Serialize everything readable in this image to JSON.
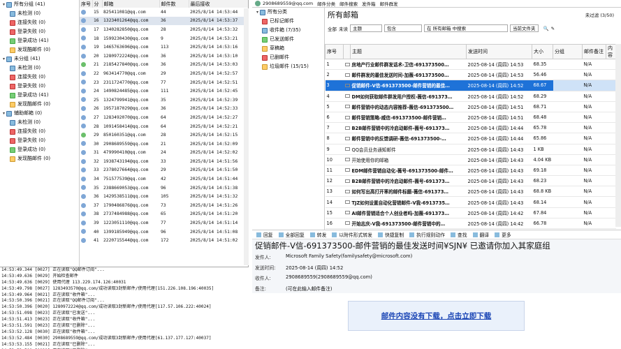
{
  "tree": [
    {
      "label": "所有分组 (41)",
      "level": 0,
      "icon": "group-icon",
      "exp": "▾"
    },
    {
      "label": "未检测 (0)",
      "level": 1,
      "icon": "blu"
    },
    {
      "label": "连接失败 (0)",
      "level": 1,
      "icon": "red"
    },
    {
      "label": "登录失败 (0)",
      "level": 1,
      "icon": "red"
    },
    {
      "label": "登录成功 (41)",
      "level": 1,
      "icon": "grn"
    },
    {
      "label": "发现酷邮件 (0)",
      "level": 1,
      "icon": "yel"
    },
    {
      "label": "未分组 (41)",
      "level": 0,
      "icon": "group-icon",
      "exp": "▾"
    },
    {
      "label": "未检测 (0)",
      "level": 1,
      "icon": "blu"
    },
    {
      "label": "连接失败 (0)",
      "level": 1,
      "icon": "red"
    },
    {
      "label": "登录失败 (0)",
      "level": 1,
      "icon": "red"
    },
    {
      "label": "登录成功 (41)",
      "level": 1,
      "icon": "grn"
    },
    {
      "label": "发现酷邮件 (0)",
      "level": 1,
      "icon": "yel"
    },
    {
      "label": "辅助邮箱 (0)",
      "level": 0,
      "icon": "group-icon",
      "exp": "▾"
    },
    {
      "label": "未检测 (0)",
      "level": 1,
      "icon": "blu"
    },
    {
      "label": "连接失败 (0)",
      "level": 1,
      "icon": "red"
    },
    {
      "label": "登录失败 (0)",
      "level": 1,
      "icon": "red"
    },
    {
      "label": "登录成功 (0)",
      "level": 1,
      "icon": "grn"
    },
    {
      "label": "发现酷邮件 (0)",
      "level": 1,
      "icon": "yel"
    }
  ],
  "grid": {
    "headers": [
      "序号",
      "分",
      "邮箱",
      "邮件数",
      "最后接收"
    ],
    "rows": [
      [
        "15",
        "825411081@qq.com",
        "44",
        "2025/8/14 14:53:44"
      ],
      [
        "16",
        "1323401264@qq.com",
        "36",
        "2025/8/14 14:53:37"
      ],
      [
        "17",
        "1340282850@qq.com",
        "28",
        "2025/8/14 14:53:32"
      ],
      [
        "18",
        "1599230430@qq.com",
        "9",
        "2025/8/14 14:53:21"
      ],
      [
        "19",
        "1465763696@qq.com",
        "113",
        "2025/8/14 14:53:16"
      ],
      [
        "20",
        "1280972224@qq.com",
        "36",
        "2025/8/14 14:53:10"
      ],
      [
        "21",
        "2185427840@qq.com",
        "36",
        "2025/8/14 14:53:03"
      ],
      [
        "22",
        "963414770@qq.com",
        "29",
        "2025/8/14 14:52:57"
      ],
      [
        "23",
        "2311724770@qq.com",
        "77",
        "2025/8/14 14:52:51"
      ],
      [
        "24",
        "1490824485@qq.com",
        "111",
        "2025/8/14 14:52:45"
      ],
      [
        "25",
        "1324799941@qq.com",
        "35",
        "2025/8/14 14:52:39"
      ],
      [
        "26",
        "1957187029@qq.com",
        "36",
        "2025/8/14 14:52:33"
      ],
      [
        "27",
        "1283492070@qq.com",
        "64",
        "2025/8/14 14:52:27"
      ],
      [
        "28",
        "1091458414@qq.com",
        "64",
        "2025/8/14 14:52:21"
      ],
      [
        "29",
        "850160351@qq.com",
        "28",
        "2025/8/14 14:52:15"
      ],
      [
        "30",
        "2908689559@qq.com",
        "21",
        "2025/8/14 14:52:09"
      ],
      [
        "31",
        "479990410@qq.com",
        "24",
        "2025/8/14 14:52:02"
      ],
      [
        "32",
        "1938743194@qq.com",
        "33",
        "2025/8/14 14:51:56"
      ],
      [
        "33",
        "2378027664@qq.com",
        "29",
        "2025/8/14 14:51:50"
      ],
      [
        "34",
        "751577539@qq.com",
        "42",
        "2025/8/14 14:51:44"
      ],
      [
        "35",
        "2388669053@qq.com",
        "96",
        "2025/8/14 14:51:38"
      ],
      [
        "36",
        "1429538511@qq.com",
        "105",
        "2025/8/14 14:51:32"
      ],
      [
        "37",
        "1790486876@qq.com",
        "73",
        "2025/8/14 14:51:26"
      ],
      [
        "38",
        "2737484988@qq.com",
        "65",
        "2025/8/14 14:51:20"
      ],
      [
        "39",
        "1223051110@qq.com",
        "77",
        "2025/8/14 14:51:14"
      ],
      [
        "40",
        "1399185949@qq.com",
        "96",
        "2025/8/14 14:51:08"
      ],
      [
        "41",
        "2220715544@qq.com",
        "172",
        "2025/8/14 14:51:02"
      ]
    ]
  },
  "log": [
    "14:53:49.344 [0027] 正在读取\"QQ邮件订阅\"...",
    "14:53:49.636 [0029] 开始检查邮件",
    "14:53:49.636 [0029] 使用代理 113.229.174.126:40031",
    "14:53:49.798 [0027] 1283493570@qq.com/成功读取3封新邮件/使用代理[151.226.108.196:40035]",
    "14:53:49.964 [0021] 正在读取\"收件箱\"...",
    "14:53:50.396 [0021] 正在读取\"QQ邮件订阅\"...",
    "14:53:50.396 [0020] 1280972224@qq.com/成功读取3封新邮件/使用代理[117.57.106.222:40024]",
    "14:53:51.098 [0023] 正在读取\"已发送\"...",
    "14:53:51.413 [0023] 正在读取\"收件箱\"...",
    "14:53:51.591 [0023] 正在读取\"已删除\"...",
    "14:53:52.128 [0030] 正在读取\"收件箱\"...",
    "14:53:52.484 [0030] 2908689559@qq.com/成功读取3封新邮件/使用代理[61.137.177.127:40037]",
    "14:53:53.155 [0021] 正在读取\"已删除\"...",
    "14:53:53.501 [0021] 正在读取\"已删除\"..."
  ],
  "mail": {
    "header_account": "2908689559@qq.com",
    "header_items": [
      "邮件分类",
      "邮件搜索",
      "发件箱",
      "邮件群发"
    ],
    "folders": [
      {
        "label": "所有分类",
        "icon": "filter-icon",
        "cls": "blu",
        "indent": 0
      },
      {
        "label": "已标记邮件",
        "icon": "flag-icon",
        "cls": "red",
        "indent": 1
      },
      {
        "label": "收件箱 (7/35)",
        "icon": "inbox-icon",
        "cls": "blu",
        "indent": 1
      },
      {
        "label": "已发送邮件",
        "icon": "sent-icon",
        "cls": "grn",
        "indent": 1
      },
      {
        "label": "草稿箱",
        "icon": "draft-icon",
        "cls": "yel",
        "indent": 1
      },
      {
        "label": "已删邮件",
        "icon": "trash-icon",
        "cls": "red",
        "indent": 1
      },
      {
        "label": "垃圾邮件 (15/15)",
        "icon": "junk-icon",
        "cls": "yel",
        "indent": 1
      }
    ],
    "list_title": "所有邮箱",
    "count": "未过滤 (3/50)",
    "filter": [
      "全部",
      "未读",
      "主题",
      "包含",
      "在 所有邮箱 中搜索",
      "当前文件夹"
    ],
    "columns": [
      "序号",
      "",
      "主题",
      "发送时间",
      "大小",
      "分组",
      "邮件备注",
      "内容"
    ],
    "rows": [
      {
        "n": "1",
        "subj": "房地产行业邮件群发话术-卫信-691373500…",
        "time": "2025-08-14 (周四) 14:53",
        "size": "68.35",
        "grp": "",
        "note": "N/A",
        "b": true
      },
      {
        "n": "2",
        "subj": "邮件群发的最佳发送时间-加薇-691373500…",
        "time": "2025-08-14 (周四) 14:53",
        "size": "56.46",
        "grp": "",
        "note": "N/A",
        "b": true
      },
      {
        "n": "3",
        "subj": "促销邮件-V信-691373500-邮件营销的最佳…",
        "time": "2025-08-14 (周四) 14:52",
        "size": "68.67",
        "grp": "",
        "note": "N/A",
        "b": true,
        "hl": true
      },
      {
        "n": "4",
        "subj": "DM如何获取邮件群发用户授权-薇信-691373…",
        "time": "2025-08-14 (周四) 14:52",
        "size": "68.29",
        "grp": "",
        "note": "N/A",
        "b": true
      },
      {
        "n": "5",
        "subj": "邮件营销中的动态内容推荐-薇信-691373500…",
        "time": "2025-08-14 (周四) 14:51",
        "size": "68.71",
        "grp": "",
        "note": "N/A",
        "b": true
      },
      {
        "n": "6",
        "subj": "邮件营销策略-威信-691373500-邮件营销…",
        "time": "2025-08-14 (周四) 14:51",
        "size": "68.48",
        "grp": "",
        "note": "N/A",
        "b": true
      },
      {
        "n": "7",
        "subj": "B2B邮件营销中的冷启动邮件-薇号-691373…",
        "time": "2025-08-14 (周四) 14:44",
        "size": "65.78",
        "grp": "",
        "note": "N/A",
        "b": true
      },
      {
        "n": "8",
        "subj": "邮件营销中的反馈调研-薇信-691373500-…",
        "time": "2025-08-14 (周四) 14:44",
        "size": "65.86",
        "grp": "",
        "note": "N/A",
        "b": true
      },
      {
        "n": "9",
        "subj": "QQ会员业务通知邮件",
        "time": "2025-08-14 (周四) 14:43",
        "size": "1 KB",
        "grp": "",
        "note": "N/A",
        "b": false
      },
      {
        "n": "10",
        "subj": "开始使用你的邮箱",
        "time": "2025-08-14 (周四) 14:43",
        "size": "4.04 KB",
        "grp": "",
        "note": "N/A",
        "b": false
      },
      {
        "n": "11",
        "subj": "EDM邮件营销自动化-薇号-691373500-邮件…",
        "time": "2025-08-14 (周四) 14:43",
        "size": "69.18",
        "grp": "",
        "note": "N/A",
        "b": true
      },
      {
        "n": "12",
        "subj": "B2B邮件营销中的冷启动邮件-薇号-691373…",
        "time": "2025-08-14 (周四) 14:43",
        "size": "68.23",
        "grp": "",
        "note": "N/A",
        "b": true
      },
      {
        "n": "13",
        "subj": "如何写出高打开率的邮件标题-薇信-691373…",
        "time": "2025-08-14 (周四) 14:43",
        "size": "68.8 KB",
        "grp": "",
        "note": "N/A",
        "b": true
      },
      {
        "n": "14",
        "subj": "TJZ如何设置自动化营销邮件-V我-6913735…",
        "time": "2025-08-14 (周四) 14:43",
        "size": "68.14",
        "grp": "",
        "note": "N/A",
        "b": true
      },
      {
        "n": "15",
        "subj": "AI邮件营销适合个人创业者吗-加薇-691373…",
        "time": "2025-08-14 (周四) 14:42",
        "size": "67.84",
        "grp": "",
        "note": "N/A",
        "b": true
      },
      {
        "n": "16",
        "subj": "开始志庆-V我-691373500-邮件营销中的…",
        "time": "2025-08-14 (周四) 14:42",
        "size": "66.78",
        "grp": "",
        "note": "N/A",
        "b": true
      },
      {
        "n": "17",
        "subj": "B2B企业如何通过邮件开发客户-卫信-6913…",
        "time": "2025-08-14 (周四) 14:41",
        "size": "67.33",
        "grp": "",
        "note": "N/A",
        "b": true
      }
    ],
    "toolbar": [
      "回复",
      "全部回复",
      "转发",
      "以附件形式转发",
      "快捷复制",
      "执行规则动作",
      "查找",
      "翻译",
      "更多"
    ],
    "subject": "促销邮件-V信-691373500-邮件营销的最佳发送时间¥SJN¥ 已邀请你加入其家庭组",
    "meta": [
      {
        "k": "发件人:",
        "v": "Microsoft Family Safety(familysafety@microsoft.com)"
      },
      {
        "k": "发送时间:",
        "v": "2025-08-14 (周四) 14:52"
      },
      {
        "k": "收件人:",
        "v": "2908689559(2908689559@qq.com)"
      },
      {
        "k": "备注:",
        "v": "(可在此输入邮件备注)"
      }
    ],
    "download_link": "邮件内容没有下载，点击立即下载"
  }
}
